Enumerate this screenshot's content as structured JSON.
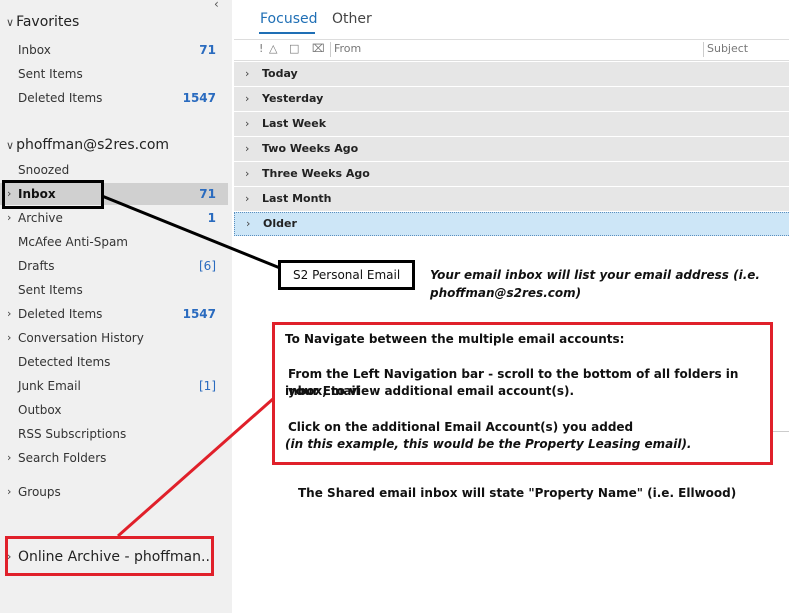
{
  "favorites": {
    "title": "Favorites",
    "items": [
      {
        "label": "Inbox",
        "count": "71"
      },
      {
        "label": "Sent Items",
        "count": ""
      },
      {
        "label": "Deleted Items",
        "count": "1547"
      }
    ]
  },
  "account": {
    "title": "phoffman@s2res.com",
    "items": [
      {
        "label": "Snoozed",
        "count": ""
      },
      {
        "label": "Inbox",
        "count": "71"
      },
      {
        "label": "Archive",
        "count": "1"
      },
      {
        "label": "McAfee Anti-Spam",
        "count": ""
      },
      {
        "label": "Drafts",
        "count": "[6]"
      },
      {
        "label": "Sent Items",
        "count": ""
      },
      {
        "label": "Deleted Items",
        "count": "1547"
      },
      {
        "label": "Conversation History",
        "count": ""
      },
      {
        "label": "Detected Items",
        "count": ""
      },
      {
        "label": "Junk Email",
        "count": "[1]"
      },
      {
        "label": "Outbox",
        "count": ""
      },
      {
        "label": "RSS Subscriptions",
        "count": ""
      },
      {
        "label": "Search Folders",
        "count": ""
      }
    ]
  },
  "groups_label": "Groups",
  "online_archive": "Online Archive - phoffman...",
  "tabs": [
    "Focused",
    "Other"
  ],
  "columns": {
    "from": "From",
    "subject": "Subject"
  },
  "date_groups": [
    "Today",
    "Yesterday",
    "Last Week",
    "Two Weeks Ago",
    "Three Weeks Ago",
    "Last Month",
    "Older"
  ],
  "annotations": {
    "callout_label": "S2 Personal Email",
    "inbox_note_1": "Your email inbox will list your email address (i.e.",
    "inbox_note_2": "phoffman@s2res.com)",
    "nav_title": "To Navigate between the multiple email accounts:",
    "nav_line1": "From the Left Navigation bar - scroll to the bottom of all folders in your Email",
    "nav_line2": "inbox, to view additional email account(s).",
    "nav_line3": "Click on the additional Email Account(s) you added",
    "nav_line4": "(in this example, this would be the Property Leasing email).",
    "shared_note": "The Shared email inbox will state \"Property Name\" (i.e. Ellwood)"
  },
  "colors": {
    "accent": "#1f6fb5",
    "count": "#2a6bbf",
    "highlight_red": "#e0202a",
    "callout_black": "#000000"
  }
}
